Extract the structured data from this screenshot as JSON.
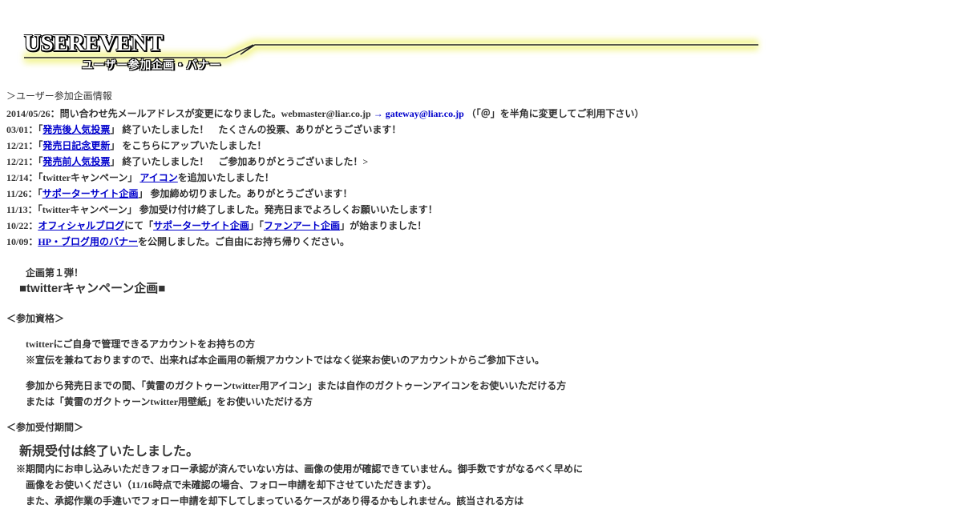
{
  "banner": {
    "title_en": "USEREVENT",
    "title_jp": "ユーザー参加企画・バナー"
  },
  "breadcrumb": "＞ユーザー参加企画情報",
  "news": {
    "r1": {
      "date": "2014/05/26：",
      "text": "問い合わせ先メールアドレスが変更になりました。webmaster@liar.co.jp",
      "arrow": "→",
      "email": "gateway@liar.co.jp",
      "note": "（「＠」を半角に変更してご利用下さい）"
    },
    "r2": {
      "date": "03/01：",
      "pre": "「",
      "link": "発売後人気投票",
      "post": "」 終了いたしました！　たくさんの投票、ありがとうございます！"
    },
    "r3": {
      "date": "12/21：",
      "pre": "「",
      "link": "発売日記念更新",
      "post": "」 をこちらにアップいたしました！"
    },
    "r4": {
      "date": "12/21：",
      "pre": "「",
      "link": "発売前人気投票",
      "post": "」 終了いたしました！　ご参加ありがとうございました！>"
    },
    "r5": {
      "date": "12/14：",
      "pre": "「twitterキャンペーン」 ",
      "link": "アイコン",
      "post": "を追加いたしました！"
    },
    "r6": {
      "date": "11/26：",
      "pre": "「",
      "link": "サポーターサイト企画",
      "post": "」 参加締め切りました。ありがとうございます！"
    },
    "r7": {
      "date": "11/13：",
      "text": "「twitterキャンペーン」 参加受け付け終了しました。発売日までよろしくお願いいたします！"
    },
    "r8": {
      "date": "10/22：",
      "link1": "オフィシャルブログ",
      "mid1": "にて「",
      "link2": "サポーターサイト企画",
      "mid2": "」「",
      "link3": "ファンアート企画",
      "post": "」が始まりました！"
    },
    "r9": {
      "date": "10/09：",
      "link": "HP・ブログ用のバナー",
      "post": "を公開しました。ご自由にお持ち帰りください。"
    }
  },
  "campaign": {
    "subtitle": "企画第１弾！",
    "title": "■twitterキャンペーン企画■",
    "eligibility_heading": "＜参加資格＞",
    "elig1": "twitterにご自身で管理できるアカウントをお持ちの方",
    "elig2": "※宣伝を兼ねておりますので、出来れば本企画用の新規アカウントではなく従来お使いのアカウントからご参加下さい。",
    "elig3": "参加から発売日までの間、「黄雷のガクトゥーンtwitter用アイコン」または自作のガクトゥーンアイコンをお使いいただける方",
    "elig4": "または「黄雷のガクトゥーンtwitter用壁紙」をお使いいただける方",
    "period_heading": "＜参加受付期間＞",
    "closed": "新規受付は終了いたしました。",
    "note1": "※期間内にお申し込みいただきフォロー承認が済んでいない方は、画像の使用が確認できていません。御手数ですがなるべく早めに",
    "note2": "画像をお使いください（11/16時点で未確認の場合、フォロー申請を却下させていただきます）。",
    "note3": "また、承認作業の手違いでフォロー申請を却下してしまっているケースがあり得るかもしれません。該当される方は"
  },
  "colors": {
    "link": "#0000cc",
    "text": "#333333",
    "banner_glow": "#e8f060"
  }
}
